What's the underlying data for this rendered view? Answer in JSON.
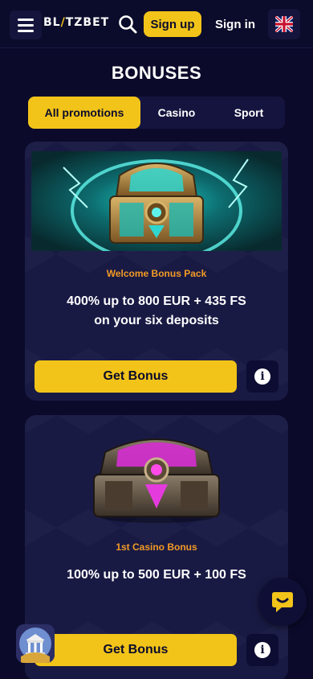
{
  "header": {
    "logo_prefix": "BL",
    "logo_accent": "/",
    "logo_suffix": "TZBET",
    "signup_label": "Sign up",
    "signin_label": "Sign in",
    "icons": [
      "menu-icon",
      "search-icon",
      "uk-flag-icon"
    ]
  },
  "page": {
    "title": "BONUSES"
  },
  "tabs": [
    {
      "label": "All promotions",
      "active": true
    },
    {
      "label": "Casino",
      "active": false
    },
    {
      "label": "Sport",
      "active": false
    }
  ],
  "cards": [
    {
      "label": "Welcome Bonus Pack",
      "title_line1": "400% up to 800 EUR + 435 FS",
      "title_line2": "on your six deposits",
      "button": "Get Bonus",
      "image": "teal-treasure-chest"
    },
    {
      "label": "1st Casino Bonus",
      "title_line1": "100% up to 500 EUR + 100 FS",
      "button": "Get Bonus",
      "image": "magenta-treasure-chest"
    }
  ],
  "colors": {
    "background": "#0b0a2a",
    "accent": "#f2c419",
    "card": "#191a44",
    "label_orange": "#f29a25"
  }
}
